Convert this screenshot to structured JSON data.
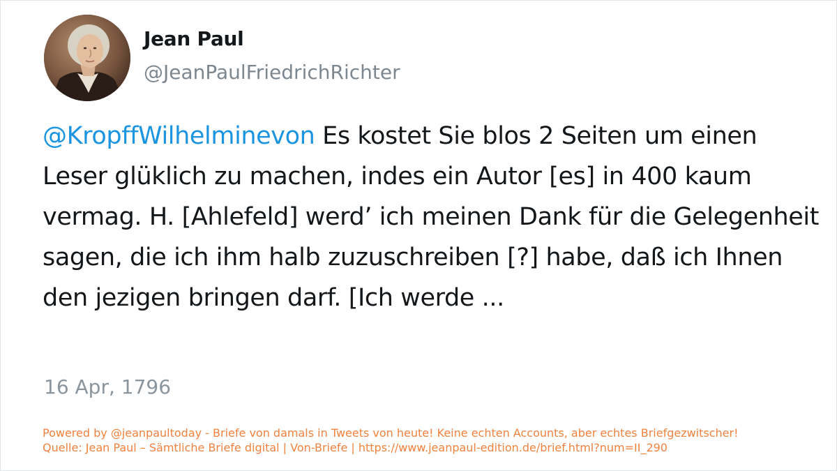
{
  "tweet": {
    "display_name": "Jean Paul",
    "handle": "@JeanPaulFriedrichRichter",
    "mention": "@KropffWilhelminevon",
    "text": " Es kostet Sie blos 2 Seiten um einen Leser glüklich zu machen, indes ein Autor [es] in 400 kaum vermag. H. [Ahlefeld] werd’ ich meinen Dank für die Gelegenheit sagen, die ich ihm halb zuzuschreiben [?] habe, daß ich Ihnen den jezigen bringen darf. [Ich werde ...",
    "date": "16 Apr, 1796",
    "avatar_icon": "portrait-avatar",
    "colors": {
      "mention": "#1b95e0",
      "text": "#14171a",
      "muted": "#7c8790",
      "footer": "#f0823f"
    }
  },
  "footer": {
    "line1": "Powered by @jeanpaultoday - Briefe von damals in Tweets von heute! Keine echten Accounts, aber echtes Briefgezwitscher!",
    "line2": "Quelle: Jean Paul – Sämtliche Briefe digital | Von-Briefe | https://www.jeanpaul-edition.de/brief.html?num=II_290"
  }
}
